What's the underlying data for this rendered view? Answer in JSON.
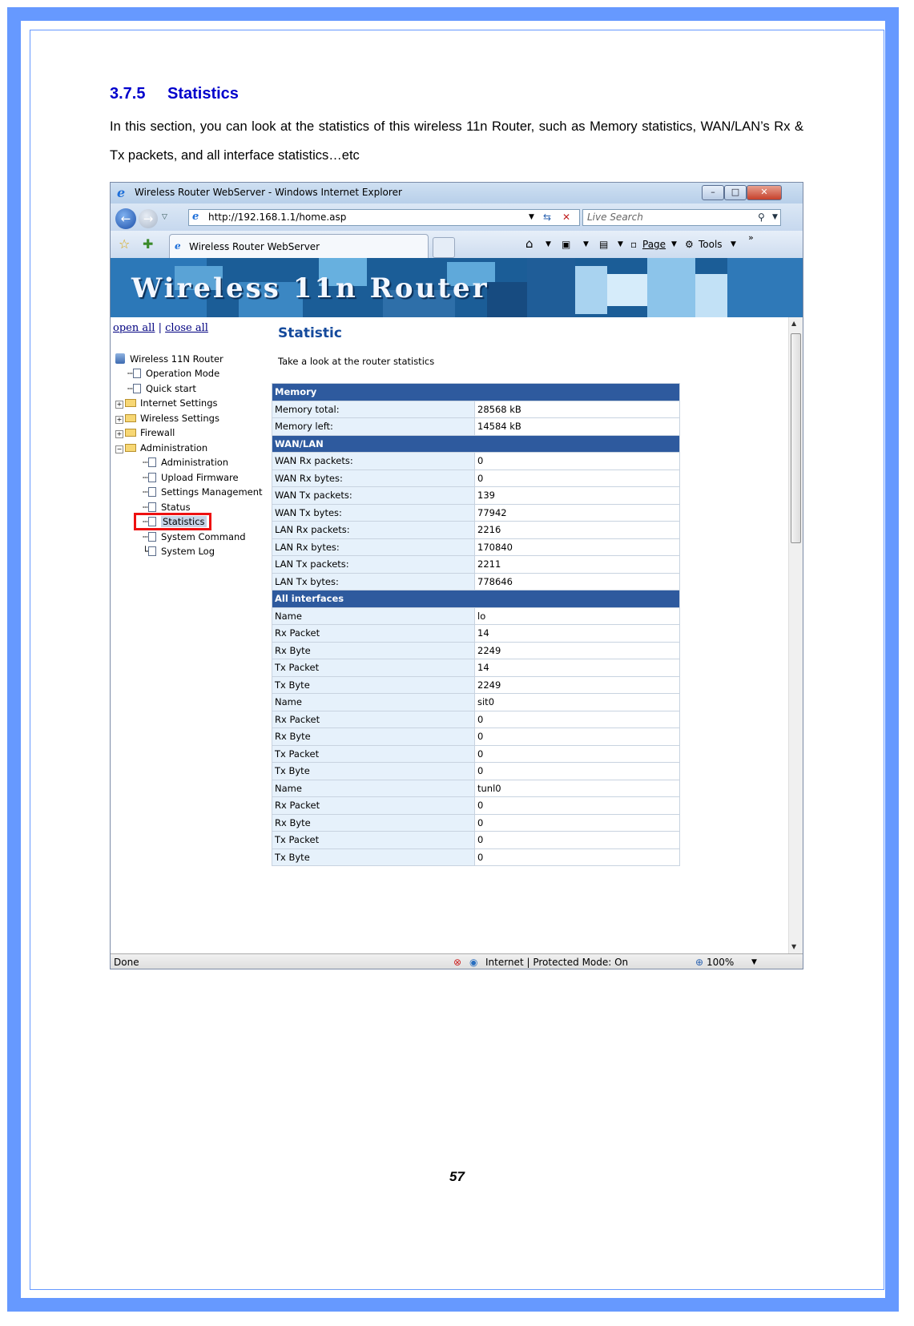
{
  "doc": {
    "section_number": "3.7.5",
    "section_title": "Statistics",
    "intro": "In this section, you can look at the statistics of this wireless 11n Router, such as Memory statistics, WAN/LAN’s Rx & Tx packets, and all interface statistics…etc",
    "page_number": "57"
  },
  "browser": {
    "window_title": "Wireless Router WebServer - Windows Internet Explorer",
    "address": "http://192.168.1.1/home.asp",
    "search_placeholder": "Live Search",
    "tab_title": "Wireless Router WebServer",
    "page_menu": "Page",
    "tools_menu": "Tools",
    "status_text": "Done",
    "zone_text": "Internet | Protected Mode: On",
    "zoom": "100%"
  },
  "banner": {
    "text": "Wireless 11n Router"
  },
  "sidebar": {
    "open_all": "open all",
    "separator": "|",
    "close_all": "close all",
    "tree": [
      {
        "label": "Wireless 11N Router",
        "type": "root"
      },
      {
        "label": "Operation Mode",
        "type": "doc"
      },
      {
        "label": "Quick start",
        "type": "doc"
      },
      {
        "label": "Internet Settings",
        "type": "folder",
        "expander": "+"
      },
      {
        "label": "Wireless Settings",
        "type": "folder",
        "expander": "+"
      },
      {
        "label": "Firewall",
        "type": "folder",
        "expander": "+"
      },
      {
        "label": "Administration",
        "type": "folder",
        "expander": "−"
      },
      {
        "label": "Administration",
        "type": "doc"
      },
      {
        "label": "Upload Firmware",
        "type": "doc"
      },
      {
        "label": "Settings Management",
        "type": "doc"
      },
      {
        "label": "Status",
        "type": "doc"
      },
      {
        "label": "Statistics",
        "type": "doc",
        "selected": true
      },
      {
        "label": "System Command",
        "type": "doc"
      },
      {
        "label": "System Log",
        "type": "doc"
      }
    ]
  },
  "statistic": {
    "title": "Statistic",
    "subtitle": "Take a look at the router statistics",
    "rows": [
      {
        "header": "Memory"
      },
      {
        "k": "Memory total:",
        "v": "28568 kB"
      },
      {
        "k": "Memory left:",
        "v": "14584 kB"
      },
      {
        "header": "WAN/LAN"
      },
      {
        "k": "WAN Rx packets:",
        "v": "0"
      },
      {
        "k": "WAN Rx bytes:",
        "v": "0"
      },
      {
        "k": "WAN Tx packets:",
        "v": "139"
      },
      {
        "k": "WAN Tx bytes:",
        "v": "77942"
      },
      {
        "k": "LAN Rx packets:",
        "v": "2216"
      },
      {
        "k": "LAN Rx bytes:",
        "v": "170840"
      },
      {
        "k": "LAN Tx packets:",
        "v": "2211"
      },
      {
        "k": "LAN Tx bytes:",
        "v": "778646"
      },
      {
        "header": "All interfaces"
      },
      {
        "k": "Name",
        "v": "lo"
      },
      {
        "k": "Rx Packet",
        "v": "14"
      },
      {
        "k": "Rx Byte",
        "v": "2249"
      },
      {
        "k": "Tx Packet",
        "v": "14"
      },
      {
        "k": "Tx Byte",
        "v": "2249"
      },
      {
        "k": "Name",
        "v": "sit0"
      },
      {
        "k": "Rx Packet",
        "v": "0"
      },
      {
        "k": "Rx Byte",
        "v": "0"
      },
      {
        "k": "Tx Packet",
        "v": "0"
      },
      {
        "k": "Tx Byte",
        "v": "0"
      },
      {
        "k": "Name",
        "v": "tunl0"
      },
      {
        "k": "Rx Packet",
        "v": "0"
      },
      {
        "k": "Rx Byte",
        "v": "0"
      },
      {
        "k": "Tx Packet",
        "v": "0"
      },
      {
        "k": "Tx Byte",
        "v": "0"
      }
    ]
  },
  "colors": {
    "page_border": "#6699ff",
    "heading": "#0000cc",
    "table_header": "#2e5a9e",
    "highlight_box": "#ee1111"
  }
}
